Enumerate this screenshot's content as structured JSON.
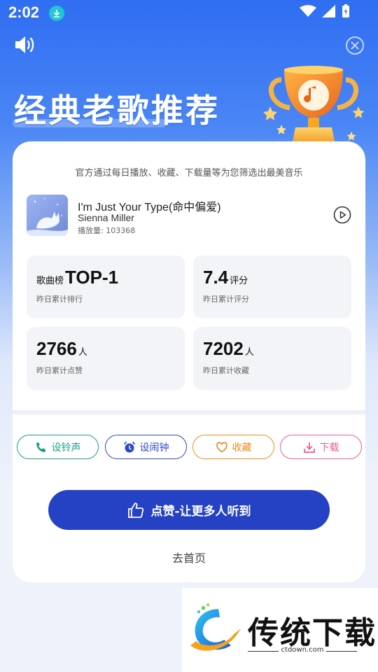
{
  "status_bar": {
    "time": "2:02"
  },
  "headline": "经典老歌推荐",
  "card": {
    "subtitle": "官方通过每日播放、收藏、下载量等为您筛选出最美音乐",
    "song": {
      "title": "I'm Just Your Type(命中偏爱)",
      "artist": "Sienna Miller",
      "plays": "播放量: 103368"
    },
    "stats": [
      {
        "prefix": "歌曲榜",
        "value": "TOP-1",
        "unit": "",
        "caption": "昨日累计排行"
      },
      {
        "prefix": "",
        "value": "7.4",
        "unit": "评分",
        "caption": "昨日累计评分"
      },
      {
        "prefix": "",
        "value": "2766",
        "unit": "人",
        "caption": "昨日累计点赞"
      },
      {
        "prefix": "",
        "value": "7202",
        "unit": "人",
        "caption": "昨日累计收藏"
      }
    ],
    "actions": [
      {
        "label": "设铃声",
        "color": "#1b9b8a",
        "icon": "phone-icon"
      },
      {
        "label": "设闹钟",
        "color": "#2d48c9",
        "icon": "alarm-clock-icon"
      },
      {
        "label": "收藏",
        "color": "#f08a1c",
        "icon": "heart-icon"
      },
      {
        "label": "下载",
        "color": "#ee5a8e",
        "icon": "download-icon"
      }
    ],
    "like_button": "点赞-让更多人听到",
    "home_link": "去首页"
  },
  "watermark": {
    "text": "传统下载",
    "url": "ctdown.com"
  }
}
